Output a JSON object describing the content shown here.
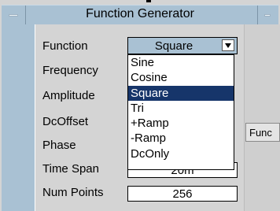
{
  "window": {
    "title": "Function Generator"
  },
  "side_button": {
    "label": "Func"
  },
  "form": {
    "function_label": "Function",
    "frequency_label": "Frequency",
    "amplitude_label": "Amplitude",
    "dcoffset_label": "DcOffset",
    "phase_label": "Phase",
    "timespan_label": "Time Span",
    "timespan_value": "20m",
    "numpoints_label": "Num Points",
    "numpoints_value": "256",
    "function_selected": "Square"
  },
  "dropdown": {
    "options": [
      "Sine",
      "Cosine",
      "Square",
      "Tri",
      "+Ramp",
      "-Ramp",
      "DcOnly"
    ],
    "selected_index": 2
  },
  "colors": {
    "titlebar": "#a9c1d3",
    "selection": "#16356a"
  }
}
